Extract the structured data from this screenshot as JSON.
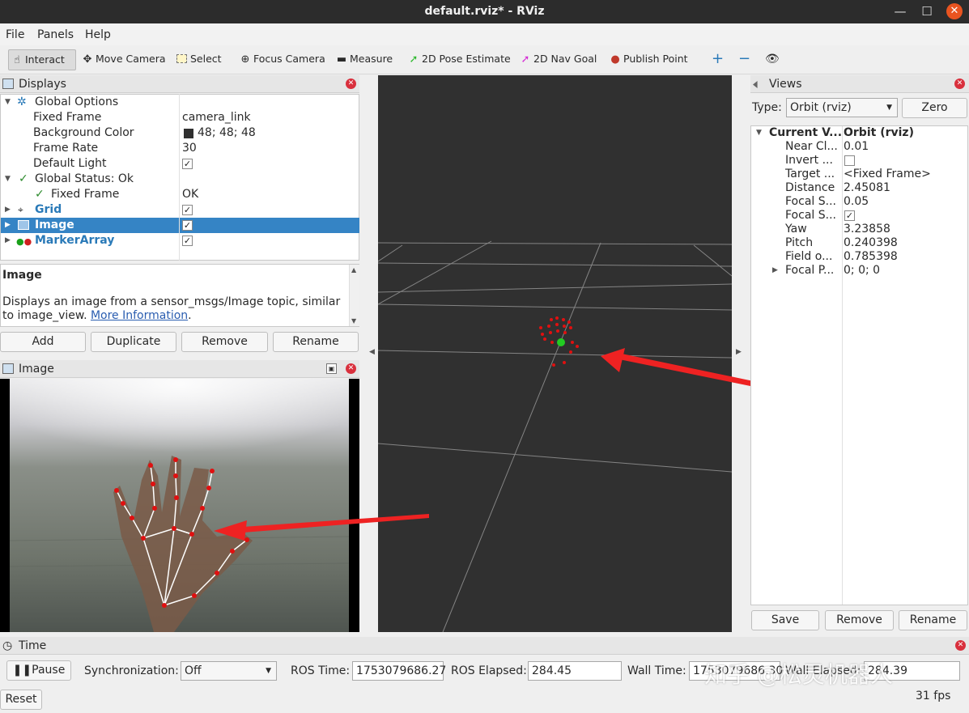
{
  "window": {
    "title": "default.rviz* - RViz",
    "minimize": "—",
    "maximize": "☐",
    "close": "✕"
  },
  "menu": {
    "file": "File",
    "panels": "Panels",
    "help": "Help"
  },
  "toolbar": {
    "interact": "Interact",
    "move_camera": "Move Camera",
    "select": "Select",
    "focus_camera": "Focus Camera",
    "measure": "Measure",
    "pose_estimate": "2D Pose Estimate",
    "nav_goal": "2D Nav Goal",
    "publish_point": "Publish Point",
    "add": "+",
    "remove": "−",
    "view": "👁"
  },
  "displays": {
    "title": "Displays",
    "global_options": "Global Options",
    "fixed_frame_label": "Fixed Frame",
    "fixed_frame_value": "camera_link",
    "bg_color_label": "Background Color",
    "bg_color_value": "48; 48; 48",
    "bg_color": "#303030",
    "frame_rate_label": "Frame Rate",
    "frame_rate_value": "30",
    "default_light_label": "Default Light",
    "global_status": "Global Status: Ok",
    "status_fixed_frame": "Fixed Frame",
    "status_ok": "OK",
    "grid": "Grid",
    "image": "Image",
    "marker_array": "MarkerArray",
    "check": "✓",
    "desc_title": "Image",
    "desc_text": "Displays an image from a sensor_msgs/Image topic, similar to image_view.",
    "desc_link": "More Information",
    "desc_end": ".",
    "btn_add": "Add",
    "btn_duplicate": "Duplicate",
    "btn_remove": "Remove",
    "btn_rename": "Rename"
  },
  "image_panel": {
    "title": "Image"
  },
  "views": {
    "title": "Views",
    "type_label": "Type:",
    "type_value": "Orbit (rviz)",
    "zero": "Zero",
    "current_label": "Current V...",
    "current_value": "Orbit (rviz)",
    "rows": [
      {
        "label": "Near Cl...",
        "value": "0.01"
      },
      {
        "label": "Invert ...",
        "value": ""
      },
      {
        "label": "Target ...",
        "value": "<Fixed Frame>"
      },
      {
        "label": "Distance",
        "value": "2.45081"
      },
      {
        "label": "Focal S...",
        "value": "0.05"
      },
      {
        "label": "Focal S...",
        "value": ""
      },
      {
        "label": "Yaw",
        "value": "3.23858"
      },
      {
        "label": "Pitch",
        "value": "0.240398"
      },
      {
        "label": "Field o...",
        "value": "0.785398"
      },
      {
        "label": "Focal P...",
        "value": "0; 0; 0"
      }
    ],
    "btn_save": "Save",
    "btn_remove": "Remove",
    "btn_rename": "Rename"
  },
  "time_panel": {
    "title": "Time",
    "pause": "Pause",
    "sync_label": "Synchronization:",
    "sync_value": "Off",
    "ros_time_label": "ROS Time:",
    "ros_time": "1753079686.27",
    "ros_elapsed_label": "ROS Elapsed:",
    "ros_elapsed": "284.45",
    "wall_time_label": "Wall Time:",
    "wall_time": "1753079686.30",
    "wall_elapsed_label": "Wall Elapsed:",
    "wall_elapsed": "284.39",
    "reset": "Reset",
    "fps": "31 fps"
  },
  "watermark": "知乎 @松灵机器人",
  "colors": {
    "accent": "#3584c5",
    "close": "#d9303d",
    "marker_red": "#e01010",
    "marker_green": "#22cc22",
    "arrow_red": "#ee2222"
  }
}
